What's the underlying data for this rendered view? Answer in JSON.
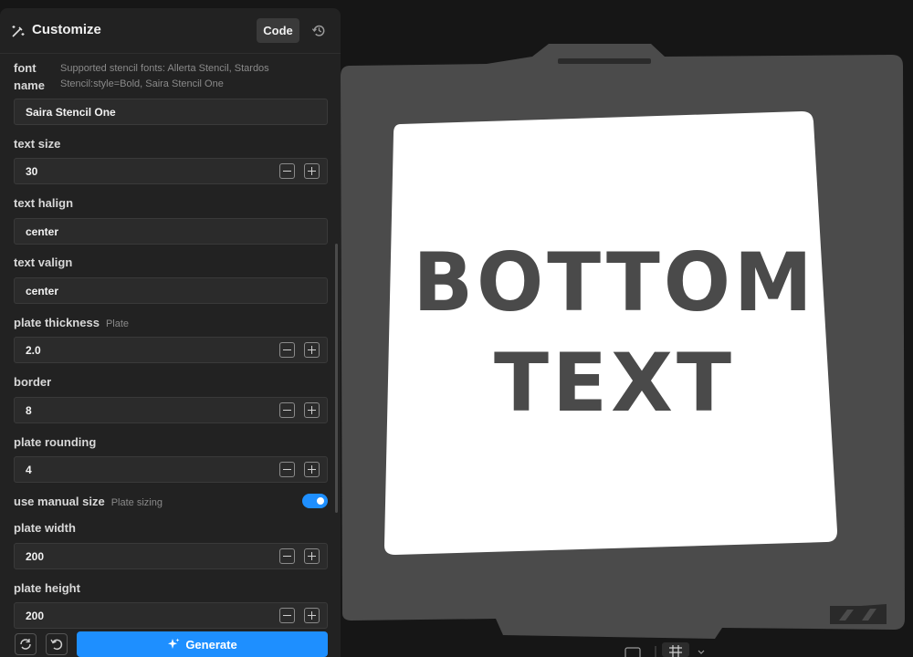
{
  "header": {
    "title": "Customize",
    "code_label": "Code"
  },
  "params": {
    "font_name_label": "font name",
    "font_name_hint": "Supported stencil fonts: Allerta Stencil, Stardos Stencil:style=Bold, Saira Stencil One",
    "font_name_value": "Saira Stencil One",
    "text_size_label": "text size",
    "text_size_value": "30",
    "text_halign_label": "text halign",
    "text_halign_value": "center",
    "text_valign_label": "text valign",
    "text_valign_value": "center",
    "plate_thickness_label": "plate thickness",
    "plate_thickness_hint": "Plate",
    "plate_thickness_value": "2.0",
    "border_label": "border",
    "border_value": "8",
    "plate_rounding_label": "plate rounding",
    "plate_rounding_value": "4",
    "use_manual_size_label": "use manual size",
    "use_manual_size_hint": "Plate sizing",
    "use_manual_size_on": true,
    "plate_width_label": "plate width",
    "plate_width_value": "200",
    "plate_height_label": "plate height",
    "plate_height_value": "200"
  },
  "footer": {
    "generate_label": "Generate"
  },
  "preview": {
    "line1": "BOTTOM",
    "line2": "TEXT"
  },
  "colors": {
    "accent": "#1e8fff",
    "plate": "#4a4a4a",
    "stencil_face": "#ffffff"
  }
}
